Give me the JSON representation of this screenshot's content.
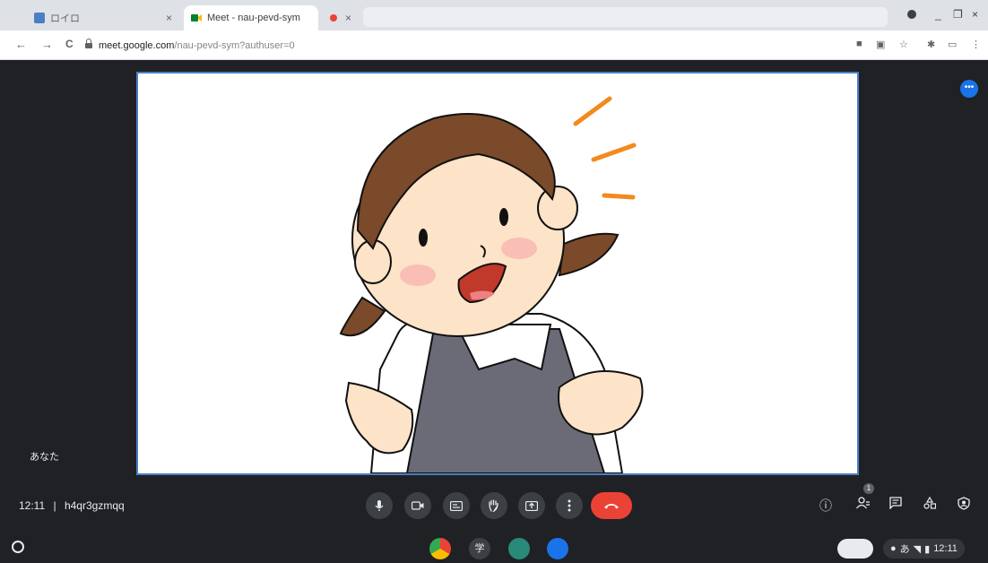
{
  "browser": {
    "tabs": [
      {
        "title": "ロイロ",
        "active": false,
        "close": "×"
      },
      {
        "title": "Meet - nau-pevd-sym",
        "active": true,
        "close": "×"
      },
      {
        "title": "",
        "active": false,
        "close": "×"
      }
    ],
    "window_controls": {
      "minimize": "_",
      "maximize": "❐",
      "close": "×"
    },
    "nav": {
      "back": "←",
      "forward": "→",
      "reload": "C"
    },
    "url_host": "meet.google.com",
    "url_path": "/nau-pevd-sym?authuser=0"
  },
  "meet": {
    "self_label": "あなた",
    "time": "12:11",
    "separator": "|",
    "meeting_code": "h4qr3gzmqq",
    "participant_badge": "1",
    "more_options": "•••",
    "controls": [
      "mic",
      "camera",
      "captions",
      "raise-hand",
      "present",
      "more",
      "end-call"
    ]
  },
  "shelf": {
    "ime_label": "学",
    "clock": "12:11",
    "status_icons": [
      "notification",
      "wifi",
      "battery"
    ]
  },
  "colors": {
    "background": "#202124",
    "video_border": "#4a7ec7",
    "end_call": "#ea4335",
    "accent": "#1a73e8"
  }
}
